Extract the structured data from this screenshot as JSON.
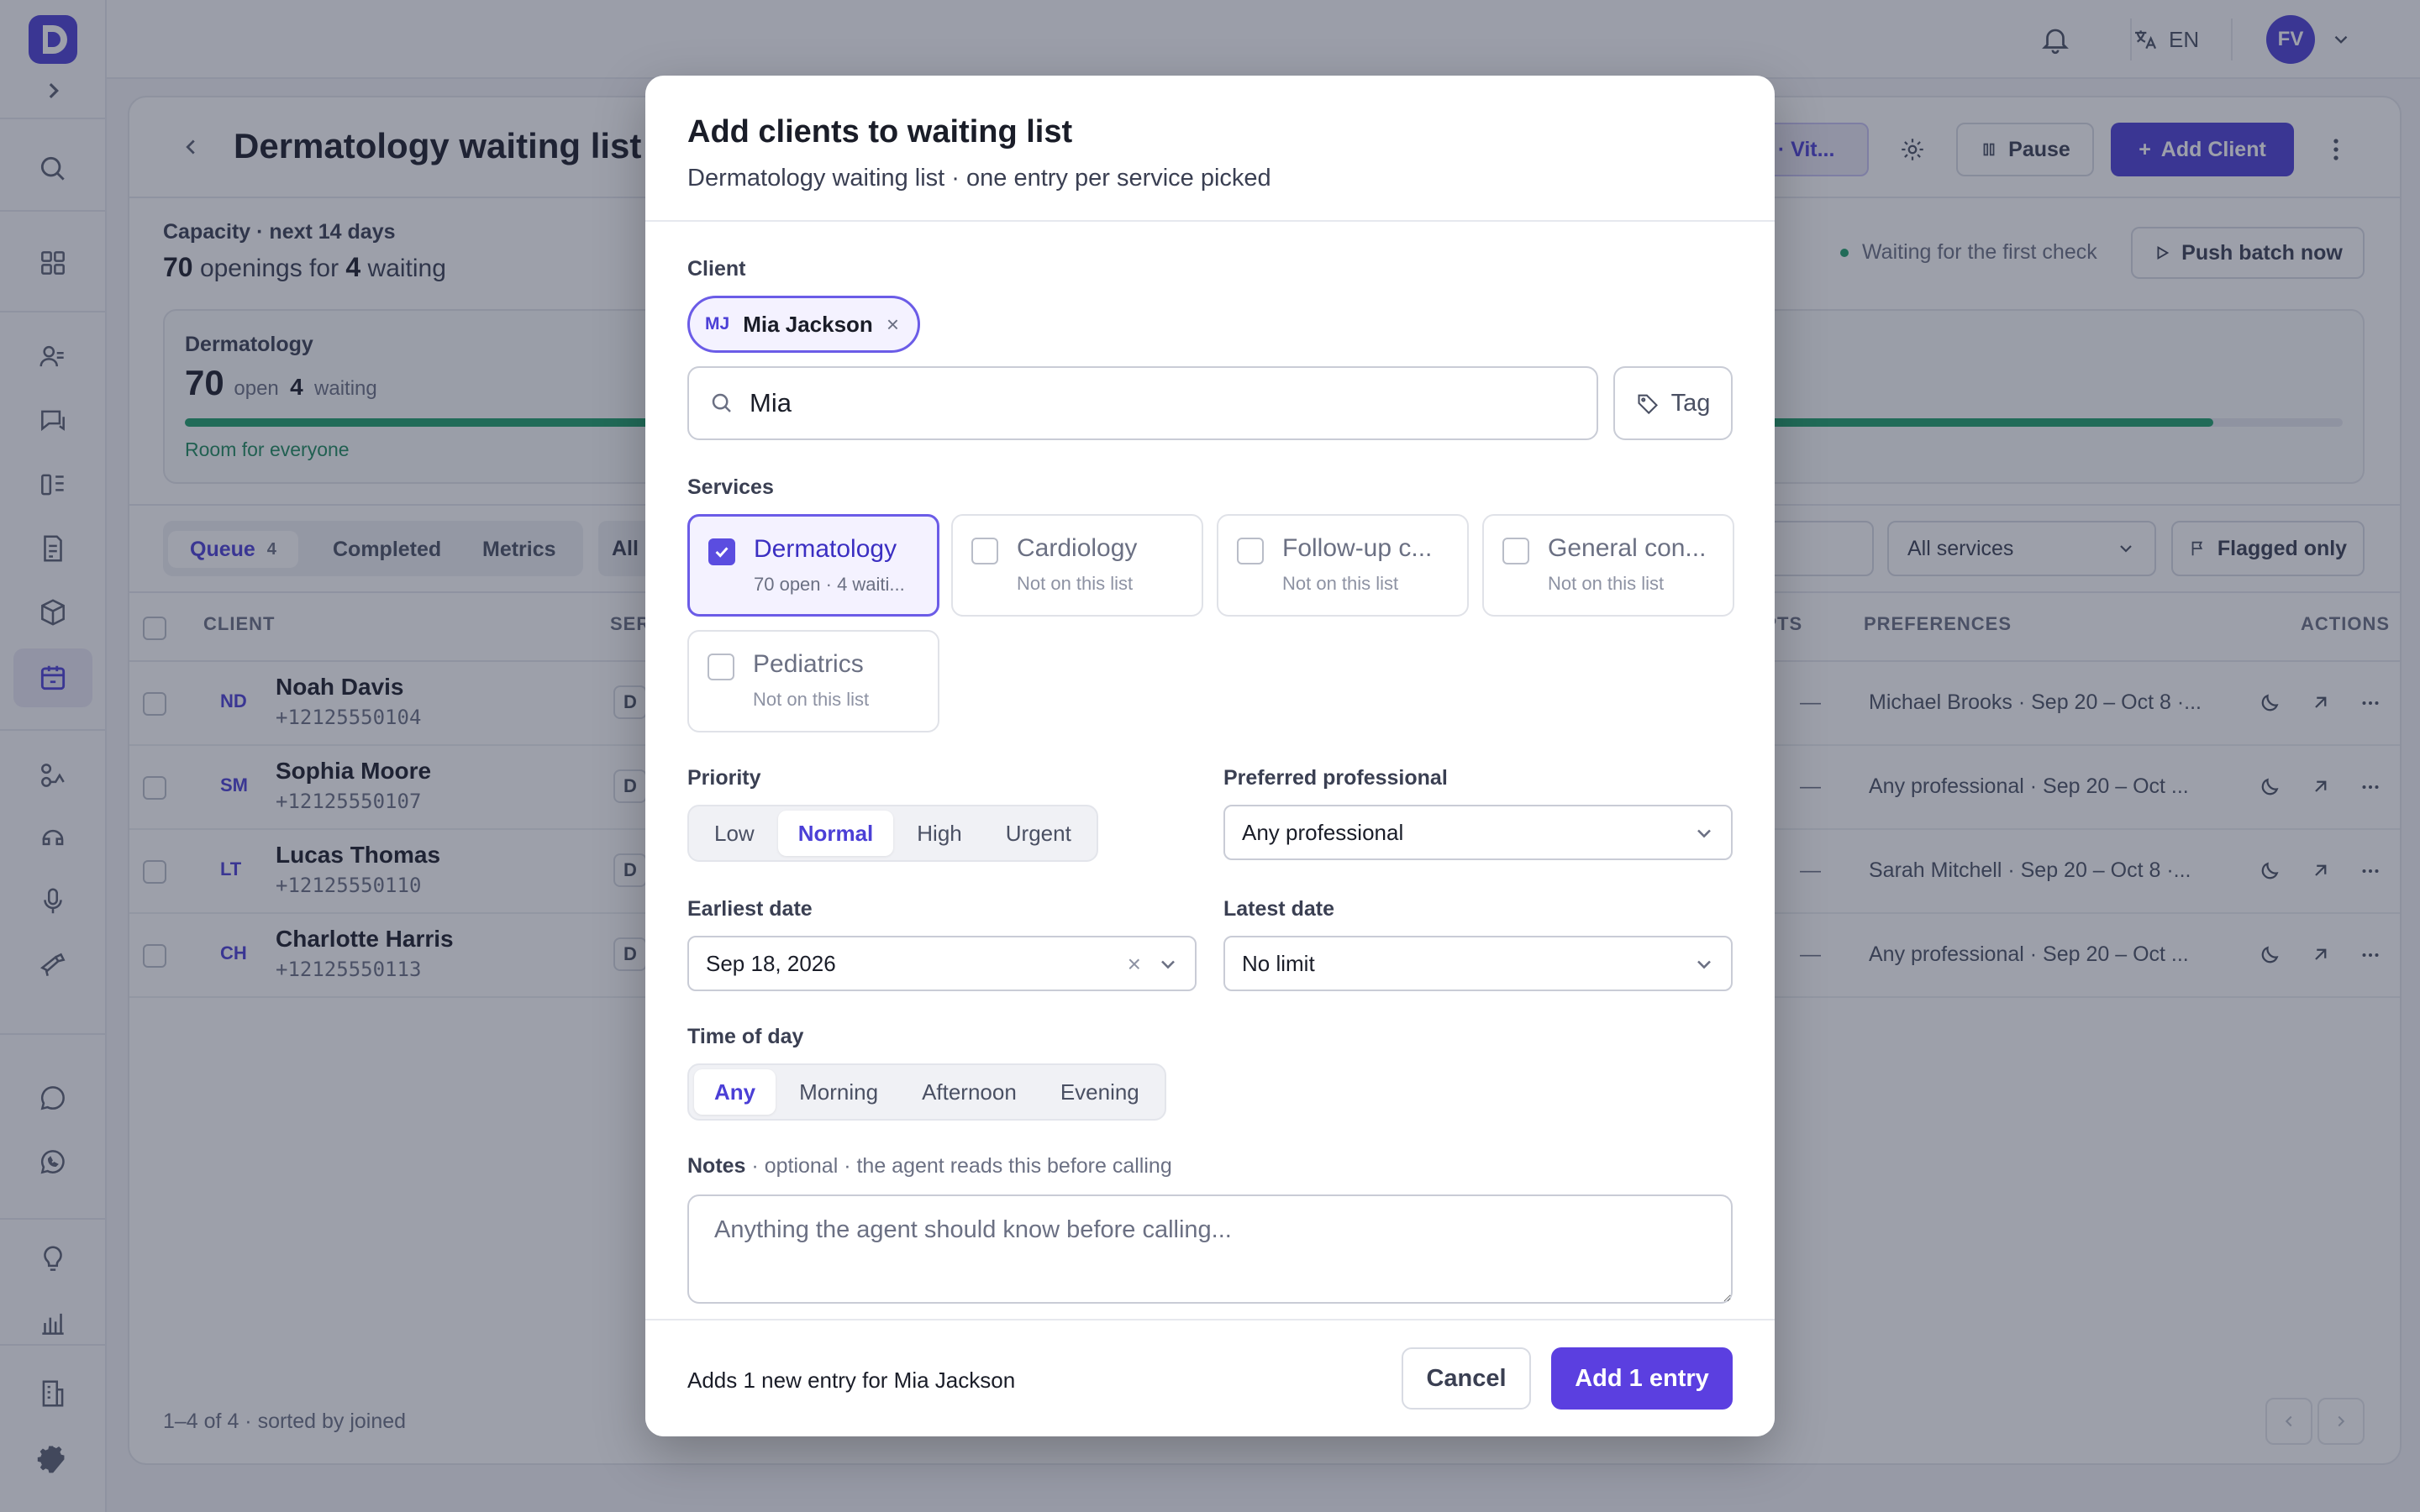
{
  "colors": {
    "accent": "#4b3fd6",
    "success": "#1e9e6a",
    "overlay": "rgba(38,44,66,0.45)"
  },
  "topbar": {
    "lang": "EN",
    "avatar_initials": "FV"
  },
  "page": {
    "title": "Dermatology waiting list",
    "agent_chip": ": · Vit...",
    "pause_label": "Pause",
    "add_client_label": "Add Client"
  },
  "capacity": {
    "label": "Capacity · next 14 days",
    "openings": "70",
    "openings_text": "openings for",
    "waiting": "4",
    "waiting_text": "waiting",
    "card_title": "Dermatology",
    "card_open": "70",
    "card_open_label": "open",
    "card_waiting": "4",
    "card_waiting_label": "waiting",
    "fill_fraction": 0.94,
    "note": "Room for everyone",
    "status": "Waiting for the first check",
    "push_label": "Push batch now"
  },
  "tabs": [
    {
      "label": "Queue",
      "count": "4"
    },
    {
      "label": "Completed"
    },
    {
      "label": "Metrics"
    }
  ],
  "filters": {
    "all_chip": "All",
    "services_select": "All services",
    "flagged": "Flagged only"
  },
  "table": {
    "headers": {
      "client": "CLIENT",
      "service": "SER",
      "attempts": "MPTS",
      "preferences": "PREFERENCES",
      "actions": "ACTIONS"
    },
    "rows": [
      {
        "initials": "ND",
        "name": "Noah Davis",
        "phone": "+12125550104",
        "service": "D",
        "attempts": "—",
        "prefs": "Michael Brooks · Sep 20 – Oct 8 ·..."
      },
      {
        "initials": "SM",
        "name": "Sophia Moore",
        "phone": "+12125550107",
        "service": "D",
        "attempts": "—",
        "prefs": "Any professional · Sep 20 – Oct ..."
      },
      {
        "initials": "LT",
        "name": "Lucas Thomas",
        "phone": "+12125550110",
        "service": "D",
        "attempts": "—",
        "prefs": "Sarah Mitchell · Sep 20 – Oct 8 ·..."
      },
      {
        "initials": "CH",
        "name": "Charlotte Harris",
        "phone": "+12125550113",
        "service": "D",
        "attempts": "—",
        "prefs": "Any professional · Sep 20 – Oct ..."
      }
    ],
    "footer": "1–4 of 4 · sorted by joined"
  },
  "modal": {
    "title": "Add clients to waiting list",
    "subtitle": "Dermatology waiting list · one entry per service picked",
    "client_label": "Client",
    "selected_client": {
      "initials": "MJ",
      "name": "Mia Jackson",
      "remove": "×"
    },
    "search_value": "Mia",
    "tag_label": "Tag",
    "services_label": "Services",
    "services": [
      {
        "name": "Dermatology",
        "meta": "70 open · 4 waiti...",
        "checked": true
      },
      {
        "name": "Cardiology",
        "meta": "Not on this list",
        "checked": false
      },
      {
        "name": "Follow-up c...",
        "meta": "Not on this list",
        "checked": false
      },
      {
        "name": "General con...",
        "meta": "Not on this list",
        "checked": false
      },
      {
        "name": "Pediatrics",
        "meta": "Not on this list",
        "checked": false
      }
    ],
    "priority_label": "Priority",
    "priority_options": [
      "Low",
      "Normal",
      "High",
      "Urgent"
    ],
    "priority_selected": "Normal",
    "professional_label": "Preferred professional",
    "professional_value": "Any professional",
    "earliest_label": "Earliest date",
    "earliest_value": "Sep 18, 2026",
    "latest_label": "Latest date",
    "latest_value": "No limit",
    "time_label": "Time of day",
    "time_options": [
      "Any",
      "Morning",
      "Afternoon",
      "Evening"
    ],
    "time_selected": "Any",
    "notes_label": "Notes",
    "notes_hint": "· optional · the agent reads this before calling",
    "notes_placeholder": "Anything the agent should know before calling...",
    "footer_text": "Adds 1 new entry for Mia Jackson",
    "cancel_label": "Cancel",
    "add_label": "Add 1 entry"
  }
}
